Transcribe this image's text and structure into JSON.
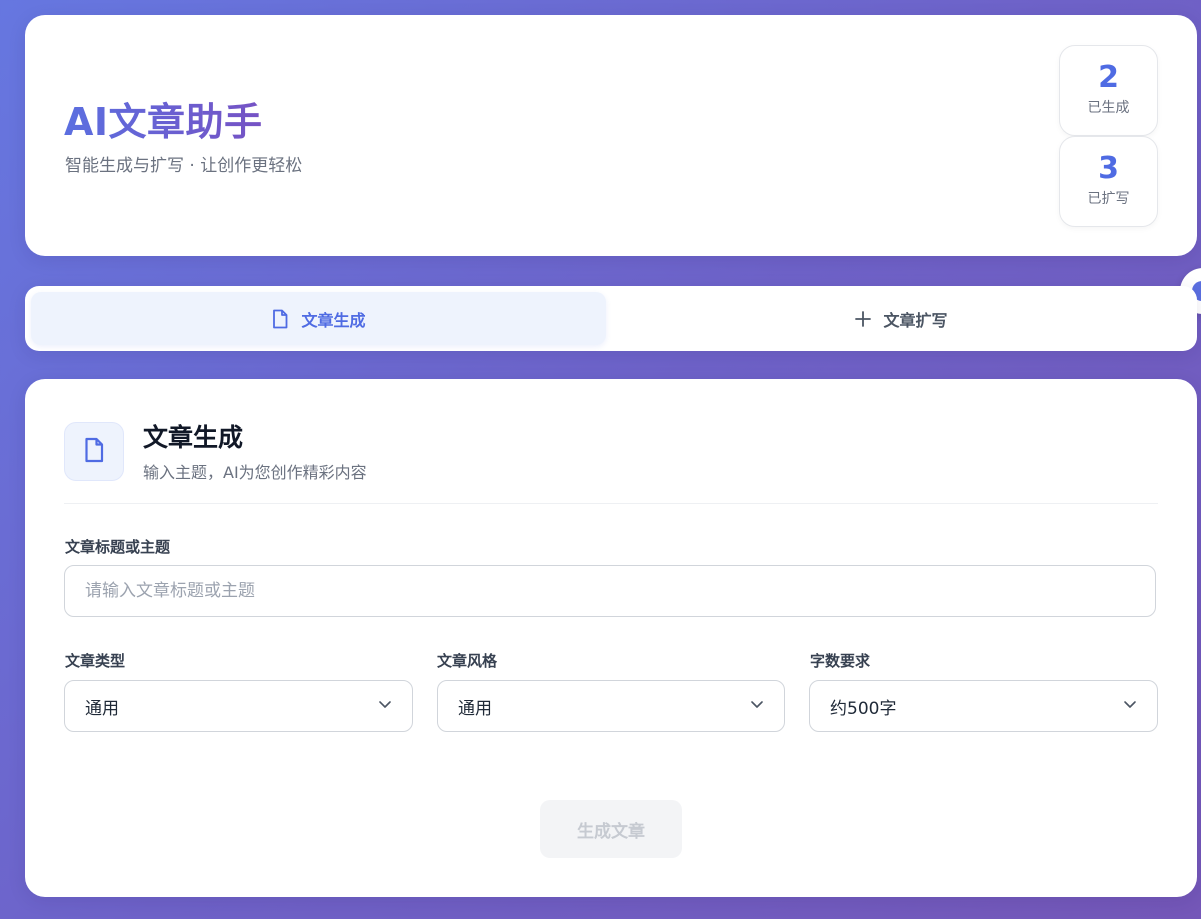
{
  "header": {
    "title": "AI文章助手",
    "subtitle": "智能生成与扩写 · 让创作更轻松",
    "stats": [
      {
        "value": "2",
        "label": "已生成"
      },
      {
        "value": "3",
        "label": "已扩写"
      }
    ]
  },
  "tabs": [
    {
      "label": "文章生成",
      "icon": "document-icon",
      "active": true
    },
    {
      "label": "文章扩写",
      "icon": "plus-icon",
      "active": false
    }
  ],
  "section": {
    "icon": "document-icon",
    "title": "文章生成",
    "description": "输入主题，AI为您创作精彩内容"
  },
  "form": {
    "title_field": {
      "label": "文章标题或主题",
      "placeholder": "请输入文章标题或主题",
      "value": ""
    },
    "type_select": {
      "label": "文章类型",
      "value": "通用"
    },
    "style_select": {
      "label": "文章风格",
      "value": "通用"
    },
    "length_select": {
      "label": "字数要求",
      "value": "约500字"
    },
    "submit_label": "生成文章"
  },
  "colors": {
    "accent": "#4f6be3",
    "gradient_start": "#6677e0",
    "gradient_end": "#7457b8"
  }
}
